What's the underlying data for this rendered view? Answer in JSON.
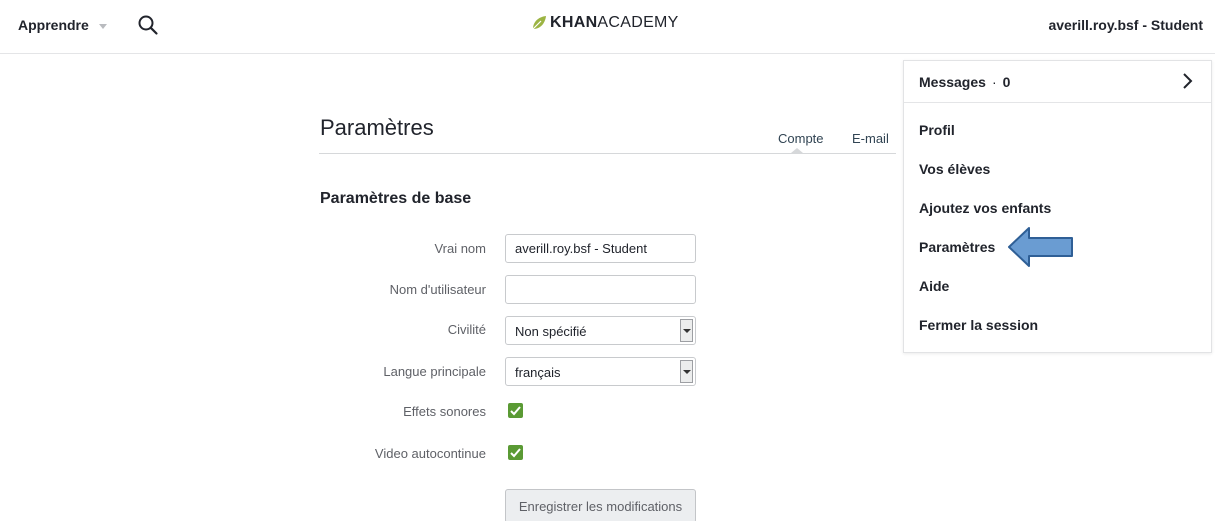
{
  "header": {
    "learn_label": "Apprendre",
    "logo_bold": "KHAN",
    "logo_light": "ACADEMY",
    "user_label": "averill.roy.bsf - Student"
  },
  "dropdown": {
    "messages_label": "Messages",
    "messages_sep": "·",
    "messages_count": "0",
    "items": [
      "Profil",
      "Vos élèves",
      "Ajoutez vos enfants",
      "Paramètres",
      "Aide",
      "Fermer la session"
    ]
  },
  "settings": {
    "title": "Paramètres",
    "tabs": [
      "Compte",
      "E-mail"
    ],
    "section_title": "Paramètres de base",
    "fields": {
      "real_name": {
        "label": "Vrai nom",
        "value": "averill.roy.bsf - Student"
      },
      "username": {
        "label": "Nom d'utilisateur",
        "value": ""
      },
      "civility": {
        "label": "Civilité",
        "value": "Non spécifié"
      },
      "language": {
        "label": "Langue principale",
        "value": "français"
      },
      "sound_effects": {
        "label": "Effets sonores",
        "checked": true
      },
      "video_autoplay": {
        "label": "Video autocontinue",
        "checked": true
      }
    },
    "save_label": "Enregistrer les modifications"
  },
  "colors": {
    "logo_leaf": "#9cb443",
    "checkbox": "#5a9a34",
    "annotation_arrow_fill": "#6a9cd2",
    "annotation_arrow_stroke": "#2f5f96"
  },
  "icons": {
    "search": "search-icon",
    "leaf": "khan-leaf-icon",
    "chevron": "chevron-right-icon",
    "check": "checkmark-icon",
    "annotation": "left-arrow-annotation"
  }
}
